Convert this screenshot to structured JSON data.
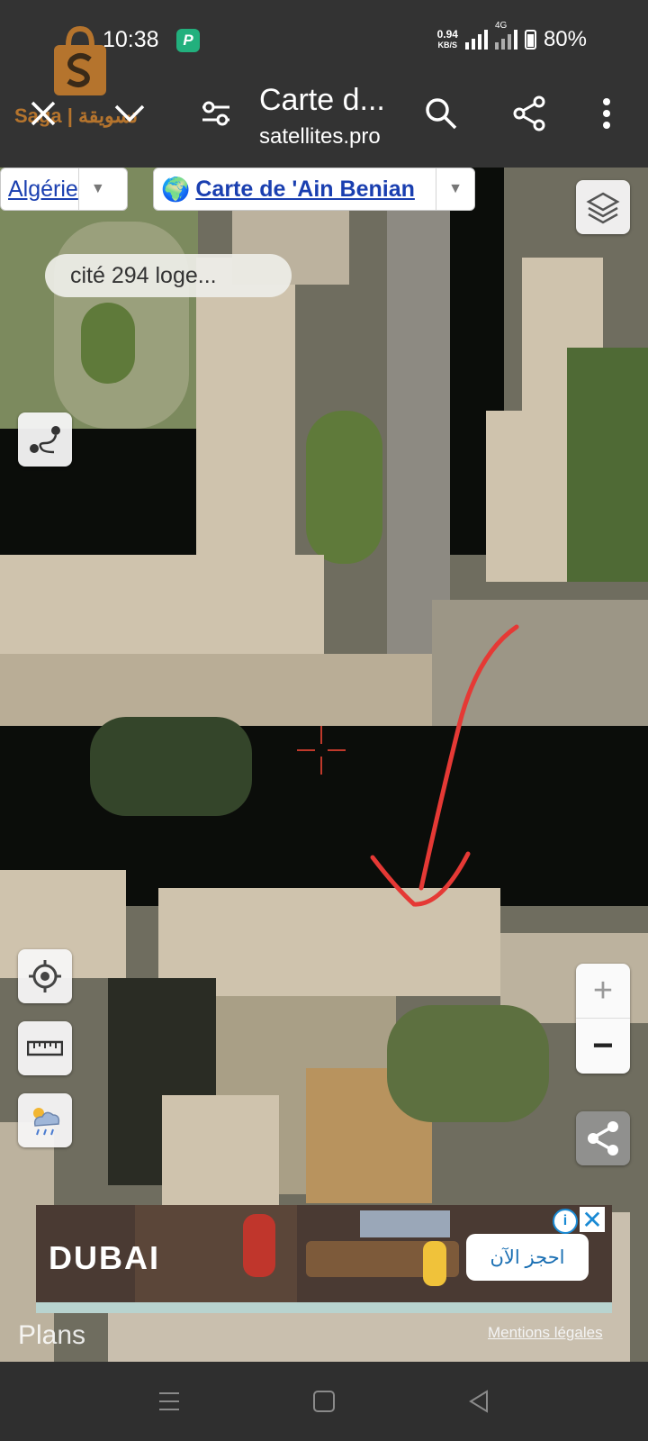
{
  "status": {
    "time": "10:38",
    "app_badge": "P",
    "net_speed_value": "0.94",
    "net_speed_unit": "KB/S",
    "network": "4G",
    "battery": "80%"
  },
  "appbar": {
    "title": "Carte d...",
    "subtitle": "satellites.pro"
  },
  "watermark": {
    "text": "Saga | تسويقة"
  },
  "map": {
    "country_select": "Algérie",
    "map_select": "Carte de 'Ain Benian",
    "map_select_icon": "globe-emoji",
    "place_label": "cité 294 loge...",
    "zoom_in": "+",
    "zoom_out": "−"
  },
  "ad": {
    "brand": "DUBAI",
    "cta": "احجز الآن",
    "info": "i",
    "close": "✕"
  },
  "footer": {
    "plans": "Plans",
    "mentions": "Mentions légales"
  },
  "colors": {
    "appbar_bg": "#333333",
    "link": "#1a3fb0",
    "annotation": "#e53935",
    "crosshair": "#c0392b"
  }
}
